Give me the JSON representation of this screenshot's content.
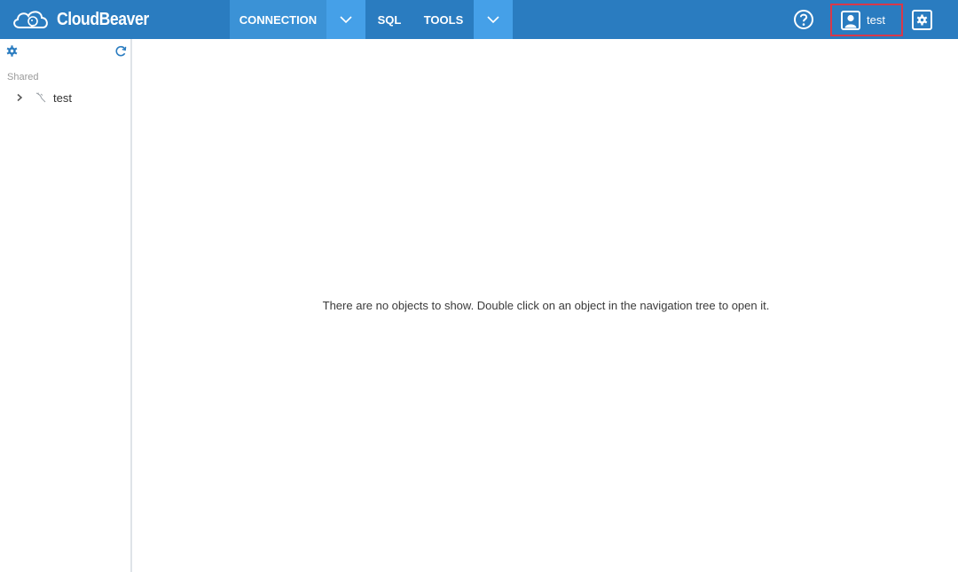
{
  "app": {
    "logo_text": "CloudBeaver",
    "brand_color": "#2a7cc0",
    "accent_color": "#45a0e8"
  },
  "topbar": {
    "menu": [
      {
        "label": "CONNECTION",
        "has_dropdown": true
      },
      {
        "label": "SQL",
        "has_dropdown": false
      },
      {
        "label": "TOOLS",
        "has_dropdown": true
      }
    ],
    "help_icon": "help-circle-icon",
    "user": {
      "name": "test",
      "icon": "user-icon",
      "highlight_color": "#d8394a"
    },
    "settings_icon": "gear-icon"
  },
  "navigator": {
    "toolbar": {
      "settings_icon": "gear-icon",
      "refresh_icon": "refresh-icon"
    },
    "section_label": "Shared",
    "nodes": [
      {
        "label": "test",
        "icon": "database-icon",
        "expanded": false
      }
    ]
  },
  "main": {
    "empty_message": "There are no objects to show. Double click on an object in the navigation tree to open it."
  }
}
